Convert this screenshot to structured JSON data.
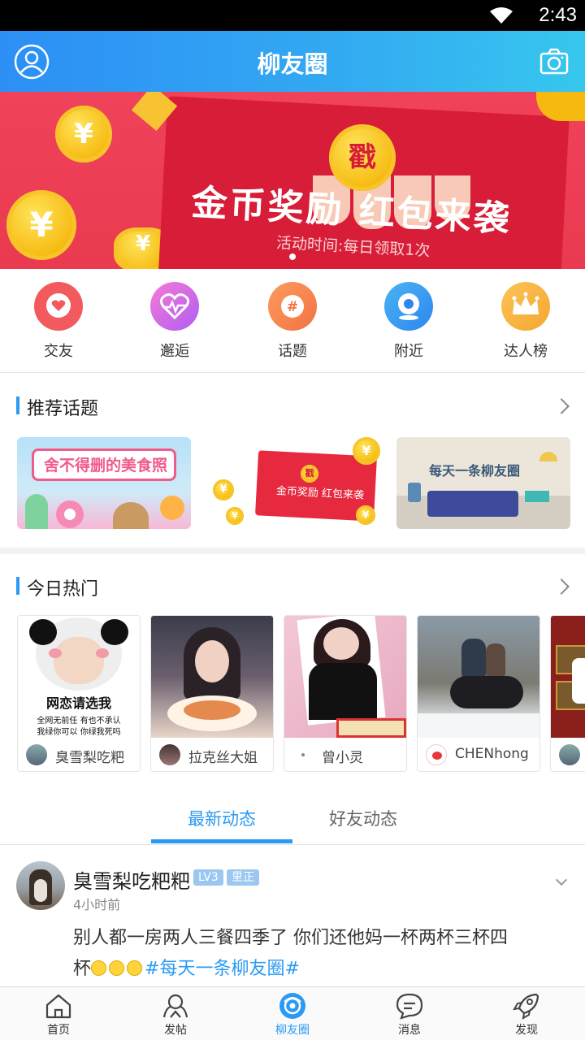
{
  "status_bar": {
    "time": "2:43"
  },
  "header": {
    "title": "柳友圈"
  },
  "banner": {
    "headline": "金币奖励 红包来袭",
    "subtitle": "活动时间:每日领取1次",
    "stamp": "戳",
    "coin_symbol": "¥"
  },
  "quick_actions": [
    {
      "label": "交友",
      "icon": "heart-chat-icon",
      "color": "#f25a5e"
    },
    {
      "label": "邂逅",
      "icon": "heartbeat-icon",
      "color": "#e65fe0"
    },
    {
      "label": "话题",
      "icon": "hashtag-icon",
      "color": "#f78a4f"
    },
    {
      "label": "附近",
      "icon": "location-icon",
      "color": "#3b9cf1"
    },
    {
      "label": "达人榜",
      "icon": "crown-icon",
      "color": "#f7b440"
    }
  ],
  "recommended": {
    "title": "推荐话题",
    "topics": [
      {
        "text": "舍不得删的美食照"
      },
      {
        "text": "金币奖励 红包来袭",
        "stamp": "戳"
      },
      {
        "text": "每天一条柳友圈"
      }
    ]
  },
  "hot_today": {
    "title": "今日热门",
    "cards": [
      {
        "user": "臭雪梨吃粑",
        "caption": "网恋请选我",
        "caption_lines": [
          "全网无前任 有也不承认",
          "我绿你可以 你绿我死吗"
        ]
      },
      {
        "user": "拉克丝大姐"
      },
      {
        "user": "曾小灵"
      },
      {
        "user": "CHENhong"
      }
    ]
  },
  "feed_tabs": {
    "active": "最新动态",
    "inactive": "好友动态"
  },
  "post": {
    "username": "臭雪梨吃粑粑",
    "level_badge": "LV3",
    "region_badge": "里正",
    "time": "4小时前",
    "text_line1": "别人都一房两人三餐四季了 你们还他妈一杯两杯三杯四",
    "text_line2_prefix": "杯",
    "hashtag": "#每天一条柳友圈#"
  },
  "bottom_nav": [
    {
      "label": "首页",
      "icon": "home-icon"
    },
    {
      "label": "发帖",
      "icon": "post-icon"
    },
    {
      "label": "柳友圈",
      "icon": "moments-icon",
      "active": true
    },
    {
      "label": "消息",
      "icon": "message-icon"
    },
    {
      "label": "发现",
      "icon": "rocket-icon"
    }
  ],
  "colors": {
    "accent": "#2b9af3",
    "banner_red": "#e93a50"
  }
}
